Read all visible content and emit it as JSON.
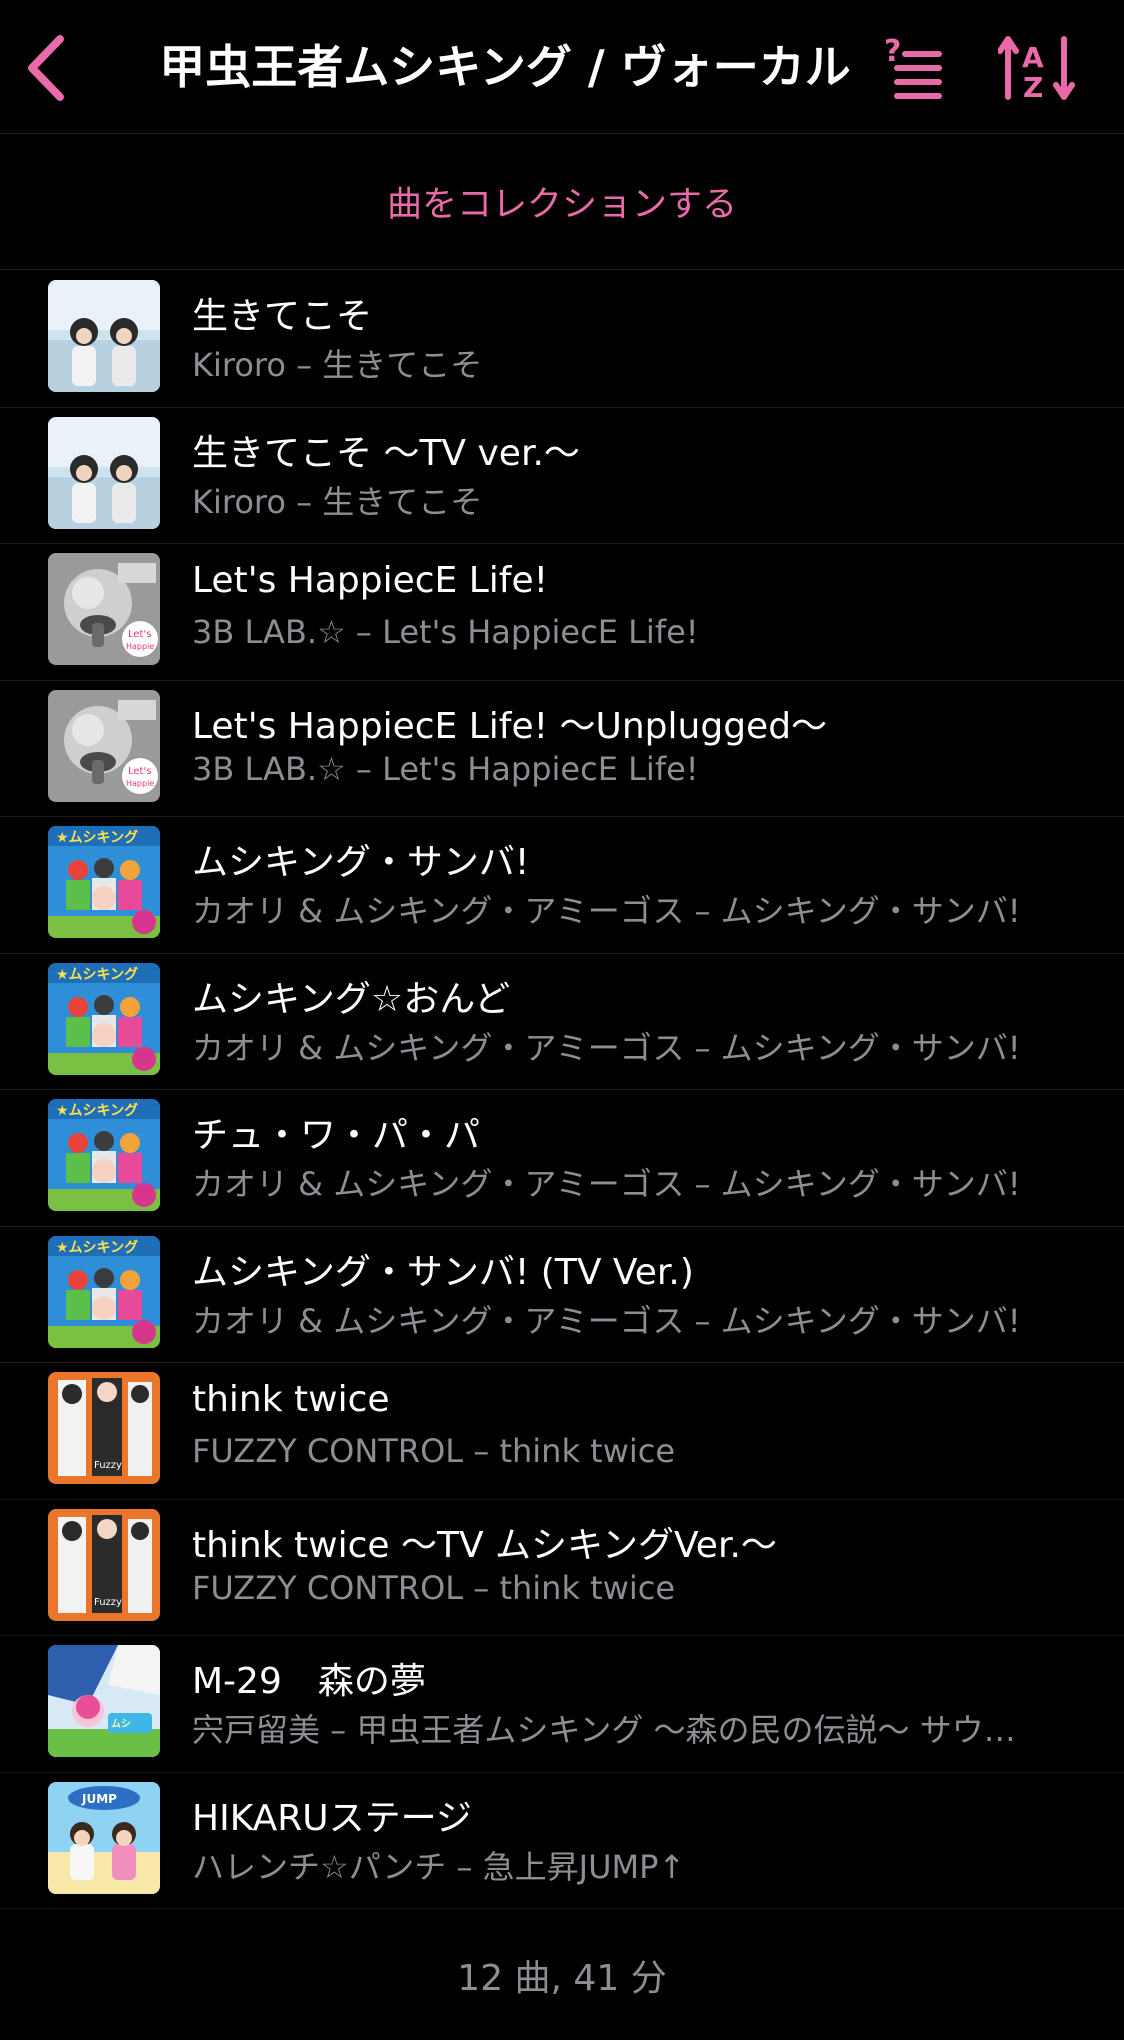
{
  "header": {
    "title": "甲虫王者ムシキング / ヴォーカル",
    "back_icon": "chevron-left-icon",
    "list_icon": "question-list-icon",
    "sort_icon": "sort-az-icon",
    "accent_color": "#e96aa8"
  },
  "collect_label": "曲をコレクションする",
  "songs": [
    {
      "title": "生きてこそ",
      "subtitle": "Kiroro – 生きてこそ",
      "art": "kiroro"
    },
    {
      "title": "生きてこそ 〜TV ver.〜",
      "subtitle": "Kiroro – 生きてこそ",
      "art": "kiroro"
    },
    {
      "title": "Let's HappiecE Life!",
      "subtitle": "3B LAB.☆ – Let's HappiecE Life!",
      "art": "3blab"
    },
    {
      "title": "Let's HappiecE Life! 〜Unplugged〜",
      "subtitle": "3B LAB.☆ – Let's HappiecE Life!",
      "art": "3blab"
    },
    {
      "title": "ムシキング・サンバ!",
      "subtitle": "カオリ & ムシキング・アミーゴス – ムシキング・サンバ!",
      "art": "samba"
    },
    {
      "title": "ムシキング☆おんど",
      "subtitle": "カオリ & ムシキング・アミーゴス – ムシキング・サンバ!",
      "art": "samba"
    },
    {
      "title": "チュ・ワ・パ・パ",
      "subtitle": "カオリ & ムシキング・アミーゴス – ムシキング・サンバ!",
      "art": "samba"
    },
    {
      "title": "ムシキング・サンバ! (TV Ver.)",
      "subtitle": "カオリ & ムシキング・アミーゴス – ムシキング・サンバ!",
      "art": "samba"
    },
    {
      "title": "think twice",
      "subtitle": "FUZZY CONTROL – think twice",
      "art": "fuzzy"
    },
    {
      "title": "think twice 〜TV ムシキングVer.〜",
      "subtitle": "FUZZY CONTROL – think twice",
      "art": "fuzzy"
    },
    {
      "title": "M-29　森の夢",
      "subtitle": "宍戸留美 – 甲虫王者ムシキング 〜森の民の伝説〜 サウ…",
      "art": "forest"
    },
    {
      "title": "HIKARUステージ",
      "subtitle": "ハレンチ☆パンチ – 急上昇JUMP↑",
      "art": "jump"
    }
  ],
  "footer_summary": "12 曲, 41 分"
}
